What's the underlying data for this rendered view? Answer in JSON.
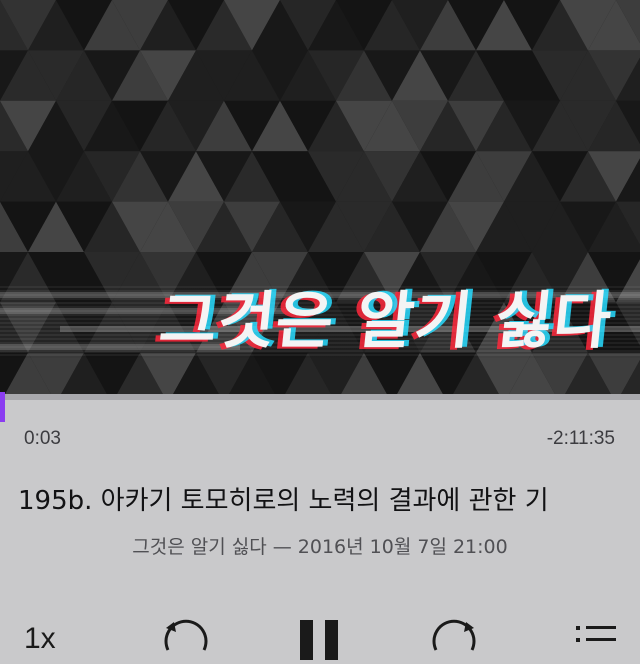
{
  "artwork": {
    "title": "그것은 알기 싫다"
  },
  "player": {
    "progress_fraction": 0.0004,
    "elapsed": "0:03",
    "remaining": "-2:11:35"
  },
  "episode": {
    "title": "195b. 아카기 토모히로의 노력의 결과에 관한 기",
    "subtitle": "그것은 알기 싫다 — 2016년 10월 7일 21:00"
  },
  "controls": {
    "speed_label": "1x",
    "skip_back_icon": "skip-back-15-icon",
    "pause_icon": "pause-icon",
    "skip_forward_icon": "skip-forward-30-icon",
    "list_icon": "list-icon"
  },
  "colors": {
    "accent": "#8a3cf0",
    "background": "#c9c9cb"
  }
}
